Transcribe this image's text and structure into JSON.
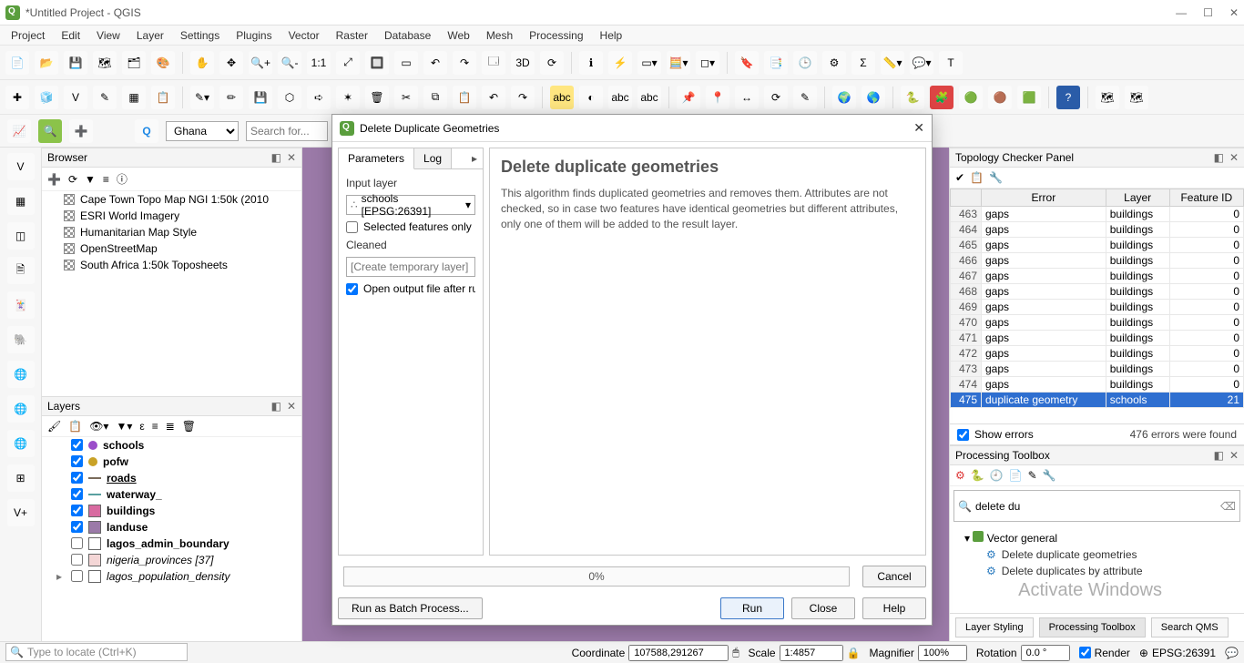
{
  "window": {
    "title": "*Untitled Project - QGIS"
  },
  "menu": [
    "Project",
    "Edit",
    "View",
    "Layer",
    "Settings",
    "Plugins",
    "Vector",
    "Raster",
    "Database",
    "Web",
    "Mesh",
    "Processing",
    "Help"
  ],
  "searchrow": {
    "combo_value": "Ghana",
    "search_placeholder": "Search for..."
  },
  "browser": {
    "title": "Browser",
    "items": [
      "Cape Town Topo Map NGI 1:50k (2010",
      "ESRI World Imagery",
      "Humanitarian Map Style",
      "OpenStreetMap",
      "South Africa 1:50k Toposheets"
    ]
  },
  "layers": {
    "title": "Layers",
    "rows": [
      {
        "checked": true,
        "type": "point",
        "color": "#9b4dca",
        "name": "schools",
        "bold": true
      },
      {
        "checked": true,
        "type": "point",
        "color": "#c9a227",
        "name": "pofw",
        "bold": true
      },
      {
        "checked": true,
        "type": "line",
        "color": "#7a6b5b",
        "name": "roads",
        "bold": true,
        "underline": true
      },
      {
        "checked": true,
        "type": "line",
        "color": "#5aa0a0",
        "name": "waterway_",
        "bold": true
      },
      {
        "checked": true,
        "type": "fill",
        "color": "#d86aa0",
        "name": "buildings",
        "bold": true
      },
      {
        "checked": true,
        "type": "fill",
        "color": "#9b7aa8",
        "name": "landuse",
        "bold": true
      },
      {
        "checked": false,
        "type": "fill",
        "color": "#ffffff",
        "name": "lagos_admin_boundary",
        "bold": true
      },
      {
        "checked": false,
        "type": "fill",
        "color": "#f4d6d6",
        "name": "nigeria_provinces [37]",
        "italic": true
      },
      {
        "checked": false,
        "type": "fill",
        "color": "#ffffff",
        "name": "lagos_population_density",
        "italic": true,
        "expand": true
      }
    ]
  },
  "dialog": {
    "title": "Delete Duplicate Geometries",
    "tabs": [
      "Parameters",
      "Log"
    ],
    "active_tab": "Parameters",
    "form": {
      "input_layer_label": "Input layer",
      "input_layer_value": "schools [EPSG:26391]",
      "selected_only_label": "Selected features only",
      "selected_only_checked": false,
      "cleaned_label": "Cleaned",
      "cleaned_placeholder": "[Create temporary layer]",
      "open_after_label": "Open output file after running algorithm",
      "open_after_checked": true
    },
    "help": {
      "heading": "Delete duplicate geometries",
      "body": "This algorithm finds duplicated geometries and removes them. Attributes are not checked, so in case two features have identical geometries but different attributes, only one of them will be added to the result layer."
    },
    "progress": "0%",
    "buttons": {
      "batch": "Run as Batch Process...",
      "run": "Run",
      "close": "Close",
      "help": "Help",
      "cancel": "Cancel"
    }
  },
  "topology": {
    "title": "Topology Checker Panel",
    "headers": [
      "Error",
      "Layer",
      "Feature ID"
    ],
    "rows": [
      {
        "n": 463,
        "error": "gaps",
        "layer": "buildings",
        "fid": 0
      },
      {
        "n": 464,
        "error": "gaps",
        "layer": "buildings",
        "fid": 0
      },
      {
        "n": 465,
        "error": "gaps",
        "layer": "buildings",
        "fid": 0
      },
      {
        "n": 466,
        "error": "gaps",
        "layer": "buildings",
        "fid": 0
      },
      {
        "n": 467,
        "error": "gaps",
        "layer": "buildings",
        "fid": 0
      },
      {
        "n": 468,
        "error": "gaps",
        "layer": "buildings",
        "fid": 0
      },
      {
        "n": 469,
        "error": "gaps",
        "layer": "buildings",
        "fid": 0
      },
      {
        "n": 470,
        "error": "gaps",
        "layer": "buildings",
        "fid": 0
      },
      {
        "n": 471,
        "error": "gaps",
        "layer": "buildings",
        "fid": 0
      },
      {
        "n": 472,
        "error": "gaps",
        "layer": "buildings",
        "fid": 0
      },
      {
        "n": 473,
        "error": "gaps",
        "layer": "buildings",
        "fid": 0
      },
      {
        "n": 474,
        "error": "gaps",
        "layer": "buildings",
        "fid": 0
      },
      {
        "n": 475,
        "error": "duplicate geometry",
        "layer": "schools",
        "fid": 21,
        "selected": true
      }
    ],
    "show_errors_label": "Show errors",
    "show_errors_checked": true,
    "count_label": "476 errors were found"
  },
  "toolbox": {
    "title": "Processing Toolbox",
    "search_value": "delete du",
    "group": "Vector general",
    "items": [
      "Delete duplicate geometries",
      "Delete duplicates by attribute"
    ]
  },
  "bottom_tabs": [
    "Layer Styling",
    "Processing Toolbox",
    "Search QMS"
  ],
  "status": {
    "locator_placeholder": "Type to locate (Ctrl+K)",
    "coord_label": "Coordinate",
    "coord_value": "107588,291267",
    "scale_label": "Scale",
    "scale_value": "1:4857",
    "magnifier_label": "Magnifier",
    "magnifier_value": "100%",
    "rotation_label": "Rotation",
    "rotation_value": "0.0 °",
    "render_label": "Render",
    "render_checked": true,
    "crs": "EPSG:26391"
  },
  "watermark": "Activate Windows"
}
